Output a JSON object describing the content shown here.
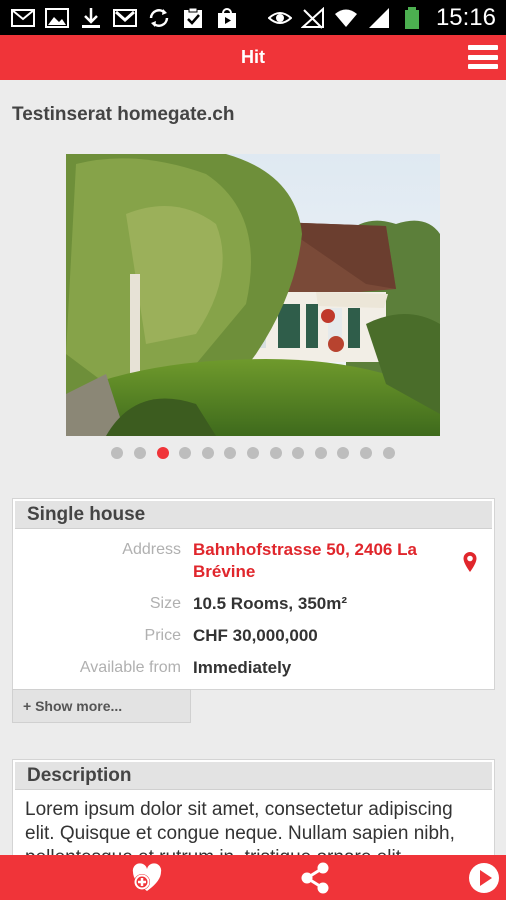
{
  "status_bar": {
    "time": "15:16",
    "left_icons": [
      "mail-icon",
      "image-icon",
      "download-icon",
      "gmail-icon",
      "sync-icon",
      "clipboard-check-icon",
      "play-store-icon"
    ],
    "right_icons": [
      "eye-icon",
      "no-signal-icon",
      "wifi-icon",
      "signal-bars-icon",
      "battery-icon"
    ]
  },
  "action_bar": {
    "title": "Hit",
    "menu_icon": "hamburger-menu-icon"
  },
  "listing": {
    "title": "Testinserat homegate.ch",
    "photo_count": 13,
    "active_photo_index": 2
  },
  "details": {
    "header": "Single house",
    "rows": [
      {
        "label": "Address",
        "value": "Bahnhofstrasse 50, 2406 La Brévine"
      },
      {
        "label": "Size",
        "value": "10.5 Rooms, 350m²"
      },
      {
        "label": "Price",
        "value": "CHF 30,000,000"
      },
      {
        "label": "Available from",
        "value": "Immediately"
      }
    ],
    "show_more_label": "+ Show more..."
  },
  "description": {
    "header": "Description",
    "text": "Lorem ipsum dolor sit amet, consectetur adipiscing elit. Quisque et congue neque. Nullam sapien nibh, pellentesque et rutrum in, tristique ornare elit."
  },
  "bottom_bar": {
    "icons": [
      "favorite-add-icon",
      "share-icon",
      "play-icon"
    ]
  },
  "colors": {
    "accent": "#f03439",
    "address": "#e0262c"
  }
}
